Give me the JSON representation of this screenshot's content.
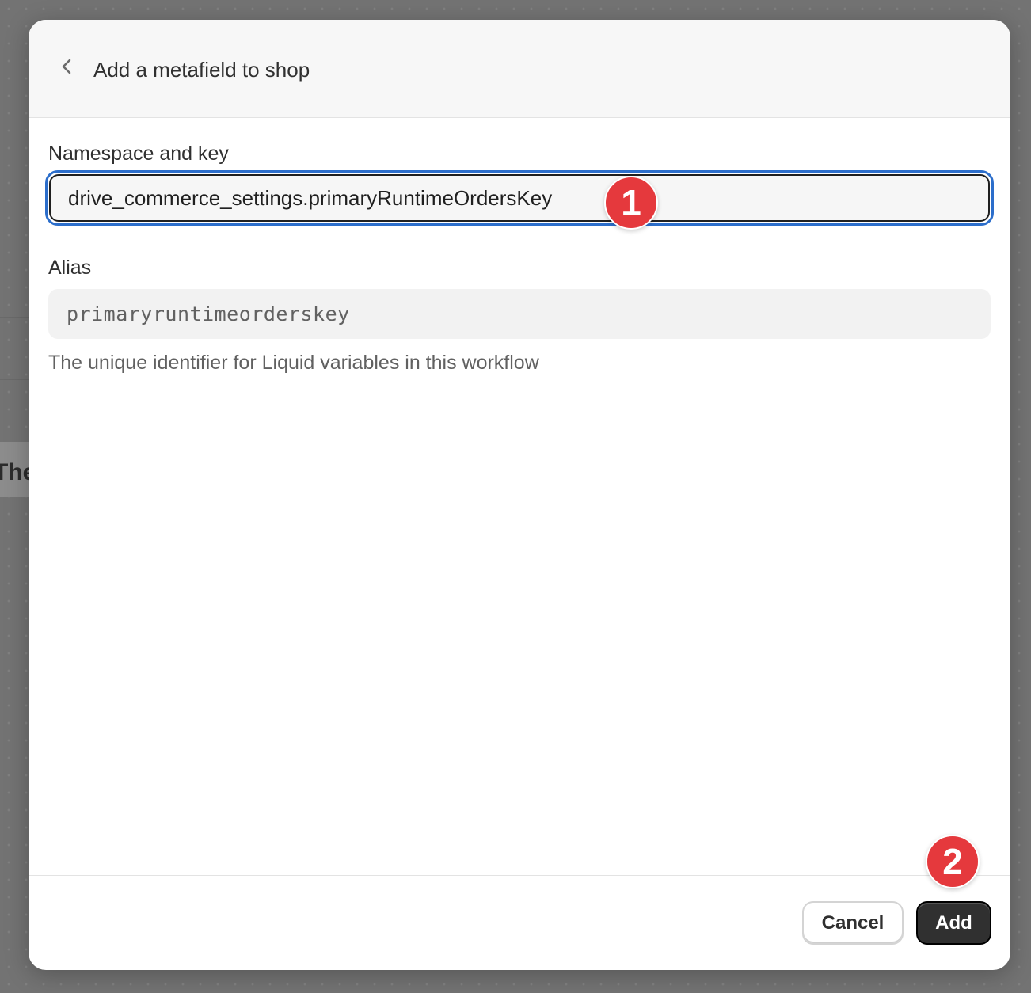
{
  "background": {
    "card_text": "The"
  },
  "dialog": {
    "title": "Add a metafield to shop",
    "back_icon": "chevron-left-icon"
  },
  "namespace_field": {
    "label": "Namespace and key",
    "value": "drive_commerce_settings.primaryRuntimeOrdersKey"
  },
  "alias_field": {
    "label": "Alias",
    "value": "primaryruntimeorderskey",
    "help_text": "The unique identifier for Liquid variables in this workflow"
  },
  "footer": {
    "cancel_label": "Cancel",
    "add_label": "Add"
  },
  "annotations": {
    "step1": "1",
    "step2": "2"
  },
  "colors": {
    "focus_ring": "#2c6ecb",
    "primary_button": "#303030",
    "badge": "#e5393d"
  }
}
